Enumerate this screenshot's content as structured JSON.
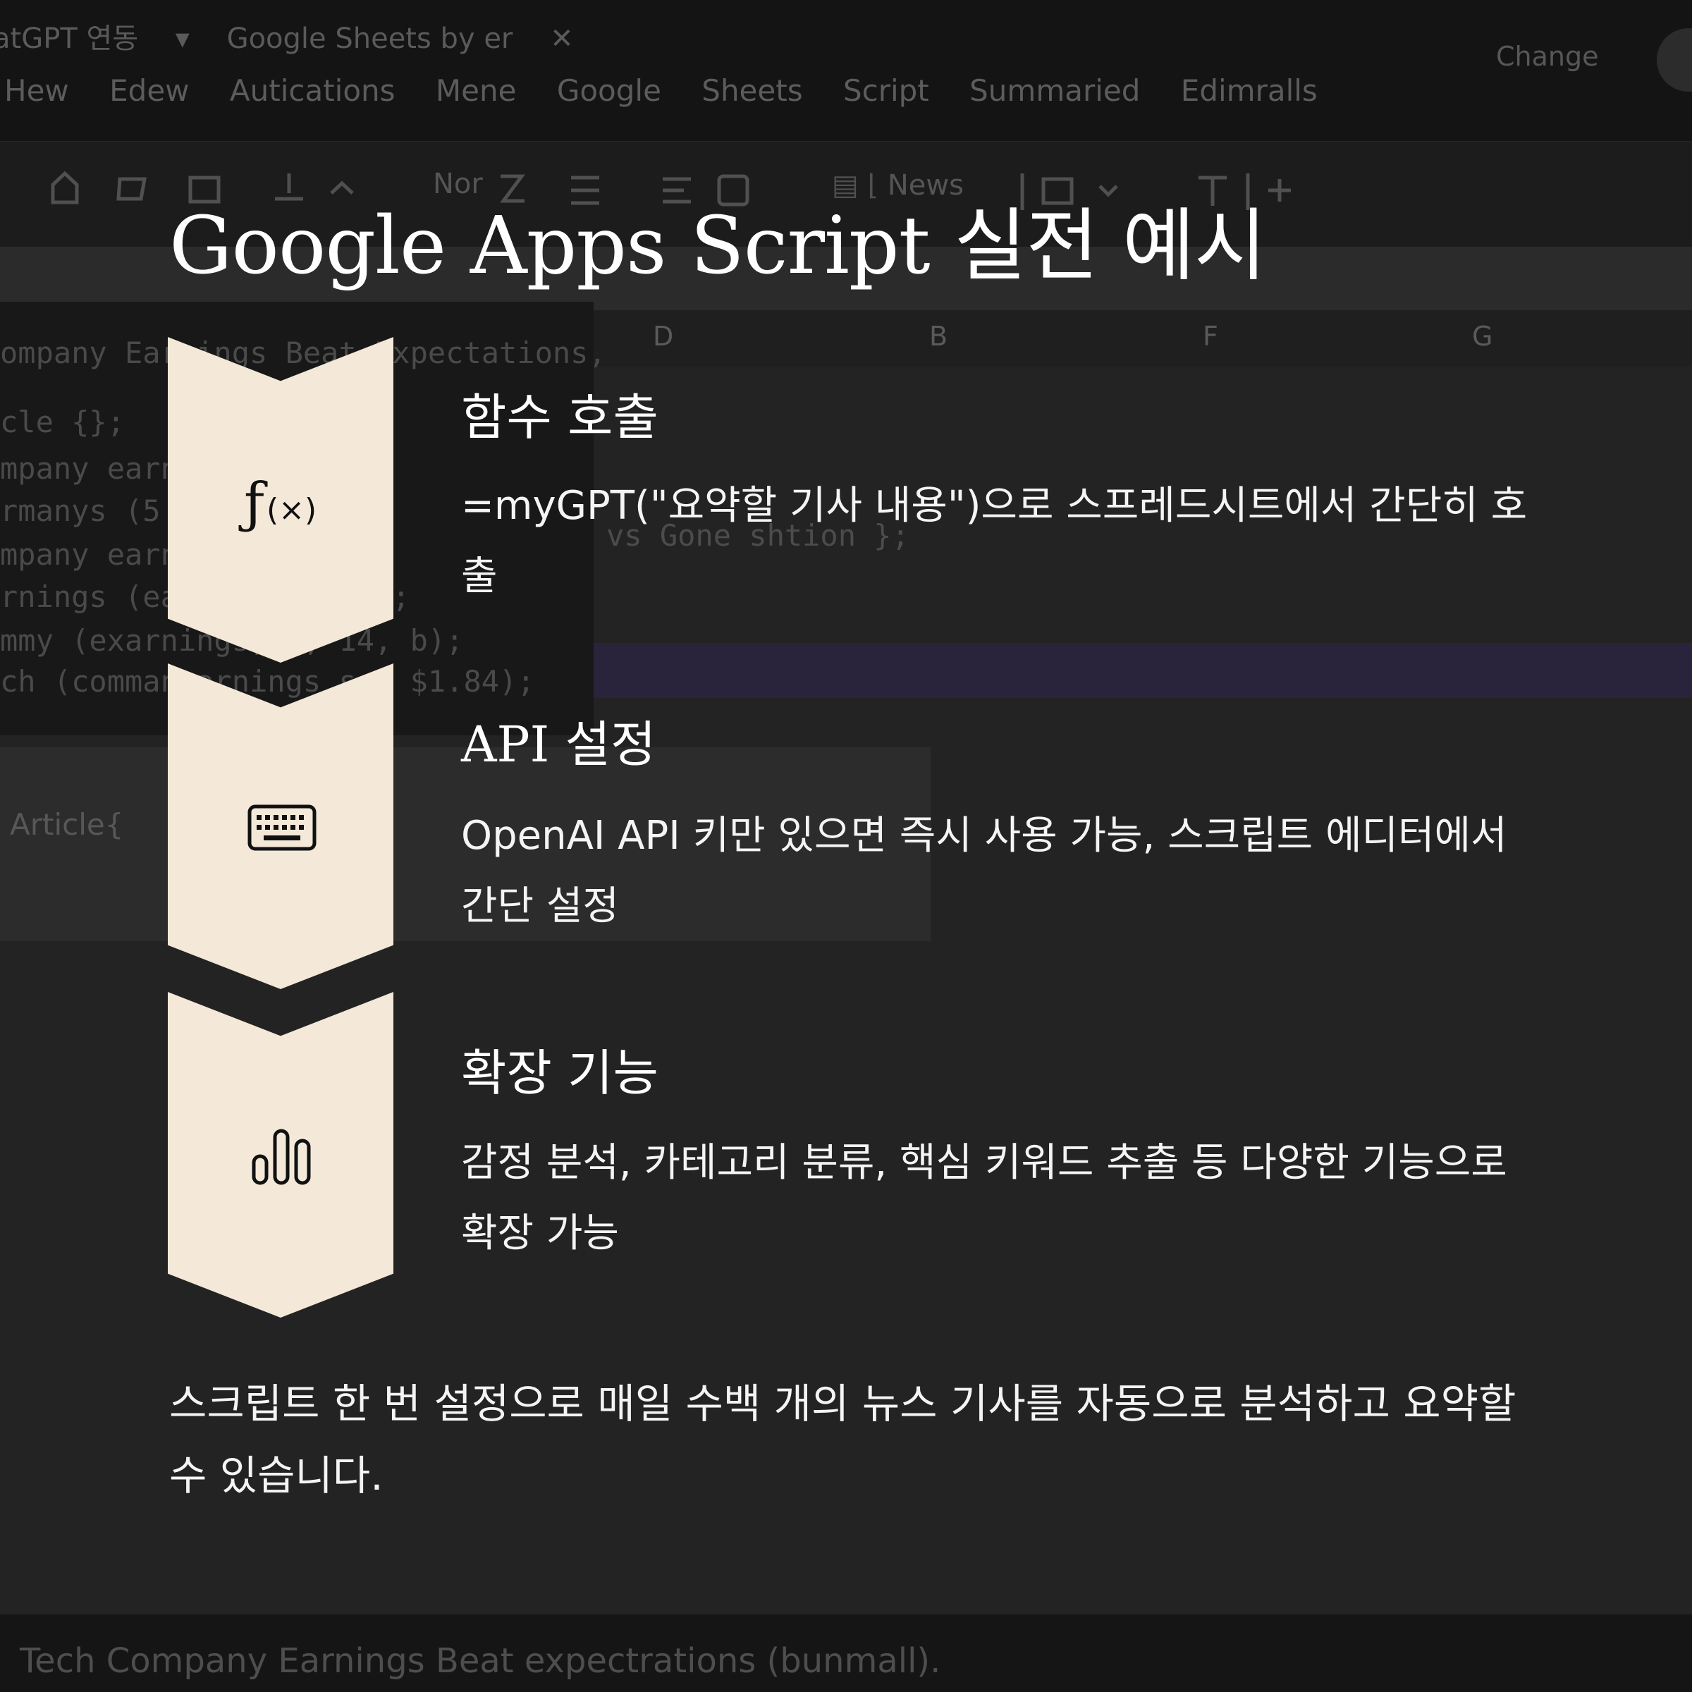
{
  "background": {
    "window_title": [
      "atGPT 연동",
      "▾",
      "Google Sheets by er",
      "✕"
    ],
    "menu": [
      "Hew",
      "Edew",
      "Autications",
      "Mene",
      "Google",
      "Sheets",
      "Script",
      "Summaried",
      "Edimralls"
    ],
    "change_label": "Change",
    "toolbar": {
      "font_label": "Nor",
      "news_label": "News"
    },
    "columns": [
      "D",
      "B",
      "F",
      "G"
    ],
    "code_lines": [
      "ompany Earnings Beat Expectations,",
      "cle {};",
      "mpany earn            5,, 11);,",
      "rmanys (5 (",
      "mpany earni            4));",
      "rnings (earn           5, 1520));",
      "mmy (exarnings,     0, 14, b);",
      "ch (comman  arnings    s,, $1.84);"
    ],
    "gone_text": "vs Gone shtion };",
    "article_label": "Article{",
    "bottom_text": "Tech Company Earnings Beat expectrations (bunmall)."
  },
  "title": "Google Apps Script 실전 예시",
  "steps": [
    {
      "icon": "function-icon",
      "icon_text": "f(×)",
      "title": "함수 호출",
      "description": "=myGPT(\"요약할 기사 내용\")으로 스프레드시트에서 간단히 호출"
    },
    {
      "icon": "keyboard-icon",
      "title": "API 설정",
      "description": "OpenAI API 키만 있으면 즉시 사용 가능, 스크립트 에디터에서 간단 설정"
    },
    {
      "icon": "bar-chart-icon",
      "title": "확장 기능",
      "description": "감정 분석, 카테고리 분류, 핵심 키워드 추출 등 다양한 기능으로 확장 가능"
    }
  ],
  "summary": "스크립트 한 번 설정으로 매일 수백 개의 뉴스 기사를 자동으로 분석하고 요약할 수 있습니다.",
  "colors": {
    "chevron": "#f4e8d8",
    "background": "#232323",
    "text": "#ffffff"
  }
}
